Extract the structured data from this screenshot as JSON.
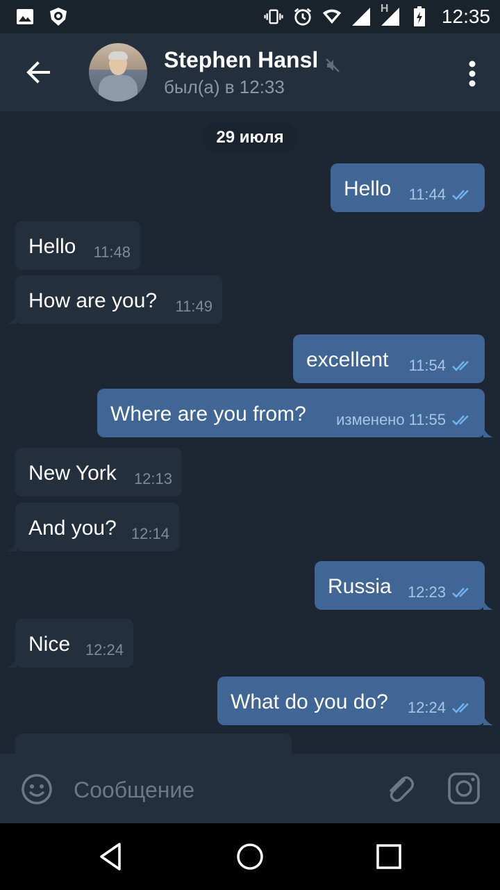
{
  "status_bar": {
    "time": "12:35",
    "network_label": "H",
    "icons": [
      "image-icon",
      "shield-app-icon",
      "vibrate-icon",
      "alarm-icon",
      "wifi-icon",
      "signal-icon",
      "signal-h-icon",
      "battery-icon"
    ]
  },
  "header": {
    "contact_name": "Stephen Hansl",
    "status": "был(а) в 12:33",
    "muted": true,
    "icons": [
      "back-arrow-icon",
      "avatar",
      "mute-icon",
      "more-vert-icon"
    ]
  },
  "chat": {
    "date_label": "29 июля",
    "messages": [
      {
        "dir": "out",
        "text": "Hello",
        "time": "11:44",
        "edited": "",
        "read": true
      },
      {
        "dir": "in",
        "text": "Hello",
        "time": "11:48"
      },
      {
        "dir": "in",
        "text": "How are you?",
        "time": "11:49"
      },
      {
        "dir": "out",
        "text": "excellent",
        "time": "11:54",
        "edited": "",
        "read": true
      },
      {
        "dir": "out",
        "text": "Where are you from?",
        "time": "11:55",
        "edited": "изменено",
        "read": true
      },
      {
        "dir": "in",
        "text": "New York",
        "time": "12:13"
      },
      {
        "dir": "in",
        "text": "And you?",
        "time": "12:14"
      },
      {
        "dir": "out",
        "text": "Russia",
        "time": "12:23",
        "edited": "",
        "read": true
      },
      {
        "dir": "in",
        "text": "Nice",
        "time": "12:24"
      },
      {
        "dir": "out",
        "text": "What do you do?",
        "time": "12:24",
        "edited": "",
        "read": true
      }
    ]
  },
  "input": {
    "placeholder": "Сообщение",
    "value": "",
    "icons": [
      "emoji-icon",
      "paperclip-icon",
      "camera-icon"
    ]
  },
  "nav_bar": {
    "icons": [
      "nav-back-icon",
      "nav-home-icon",
      "nav-recents-icon"
    ]
  },
  "colors": {
    "background": "#1d2733",
    "header": "#242f3d",
    "bubble_in": "#242f3d",
    "bubble_out": "#3f6694",
    "read_ticks": "#6fb4ee"
  }
}
